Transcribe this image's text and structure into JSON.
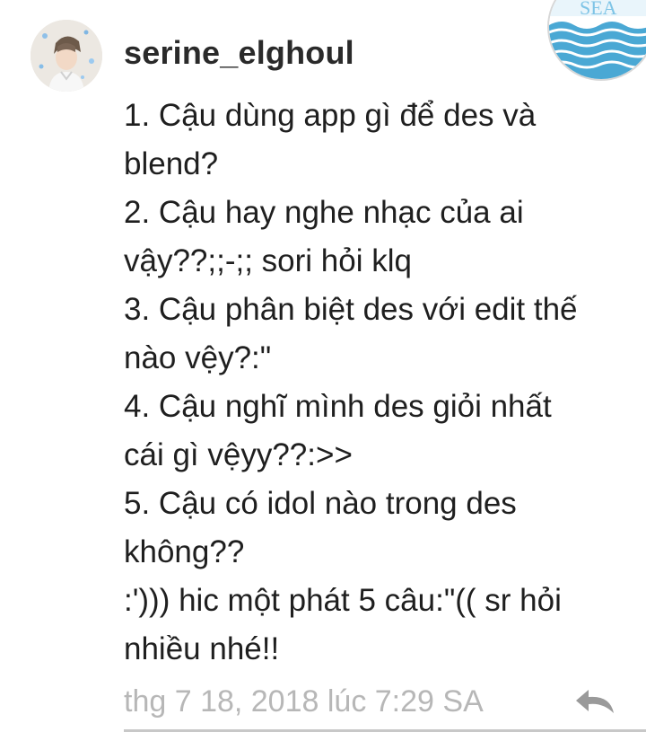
{
  "comment": {
    "username": "serine_elghoul",
    "lines": [
      "1. Cậu dùng app gì để des và",
      "blend?",
      "2. Cậu hay nghe nhạc của ai",
      "vậy??;;-;; sori hỏi klq",
      "3. Cậu phân biệt des với edit thế",
      "nào vệy?:\"",
      "4. Cậu nghĩ mình des giỏi nhất",
      "cái gì vệyy??:>>",
      "5. Cậu có idol nào trong des",
      "không??",
      ":')))  hic một phát 5 câu:\"(( sr hỏi",
      "nhiều nhé!!"
    ],
    "timestamp": "thg 7 18, 2018 lúc 7:29 SA"
  },
  "icons": {
    "avatar": "user-avatar-photo",
    "badge": "sea-logo-badge",
    "reply": "reply-arrow-icon"
  },
  "colors": {
    "text": "#1f1f1f",
    "timestamp": "#b7b7b7",
    "badge_water": "#5bb0d6"
  }
}
